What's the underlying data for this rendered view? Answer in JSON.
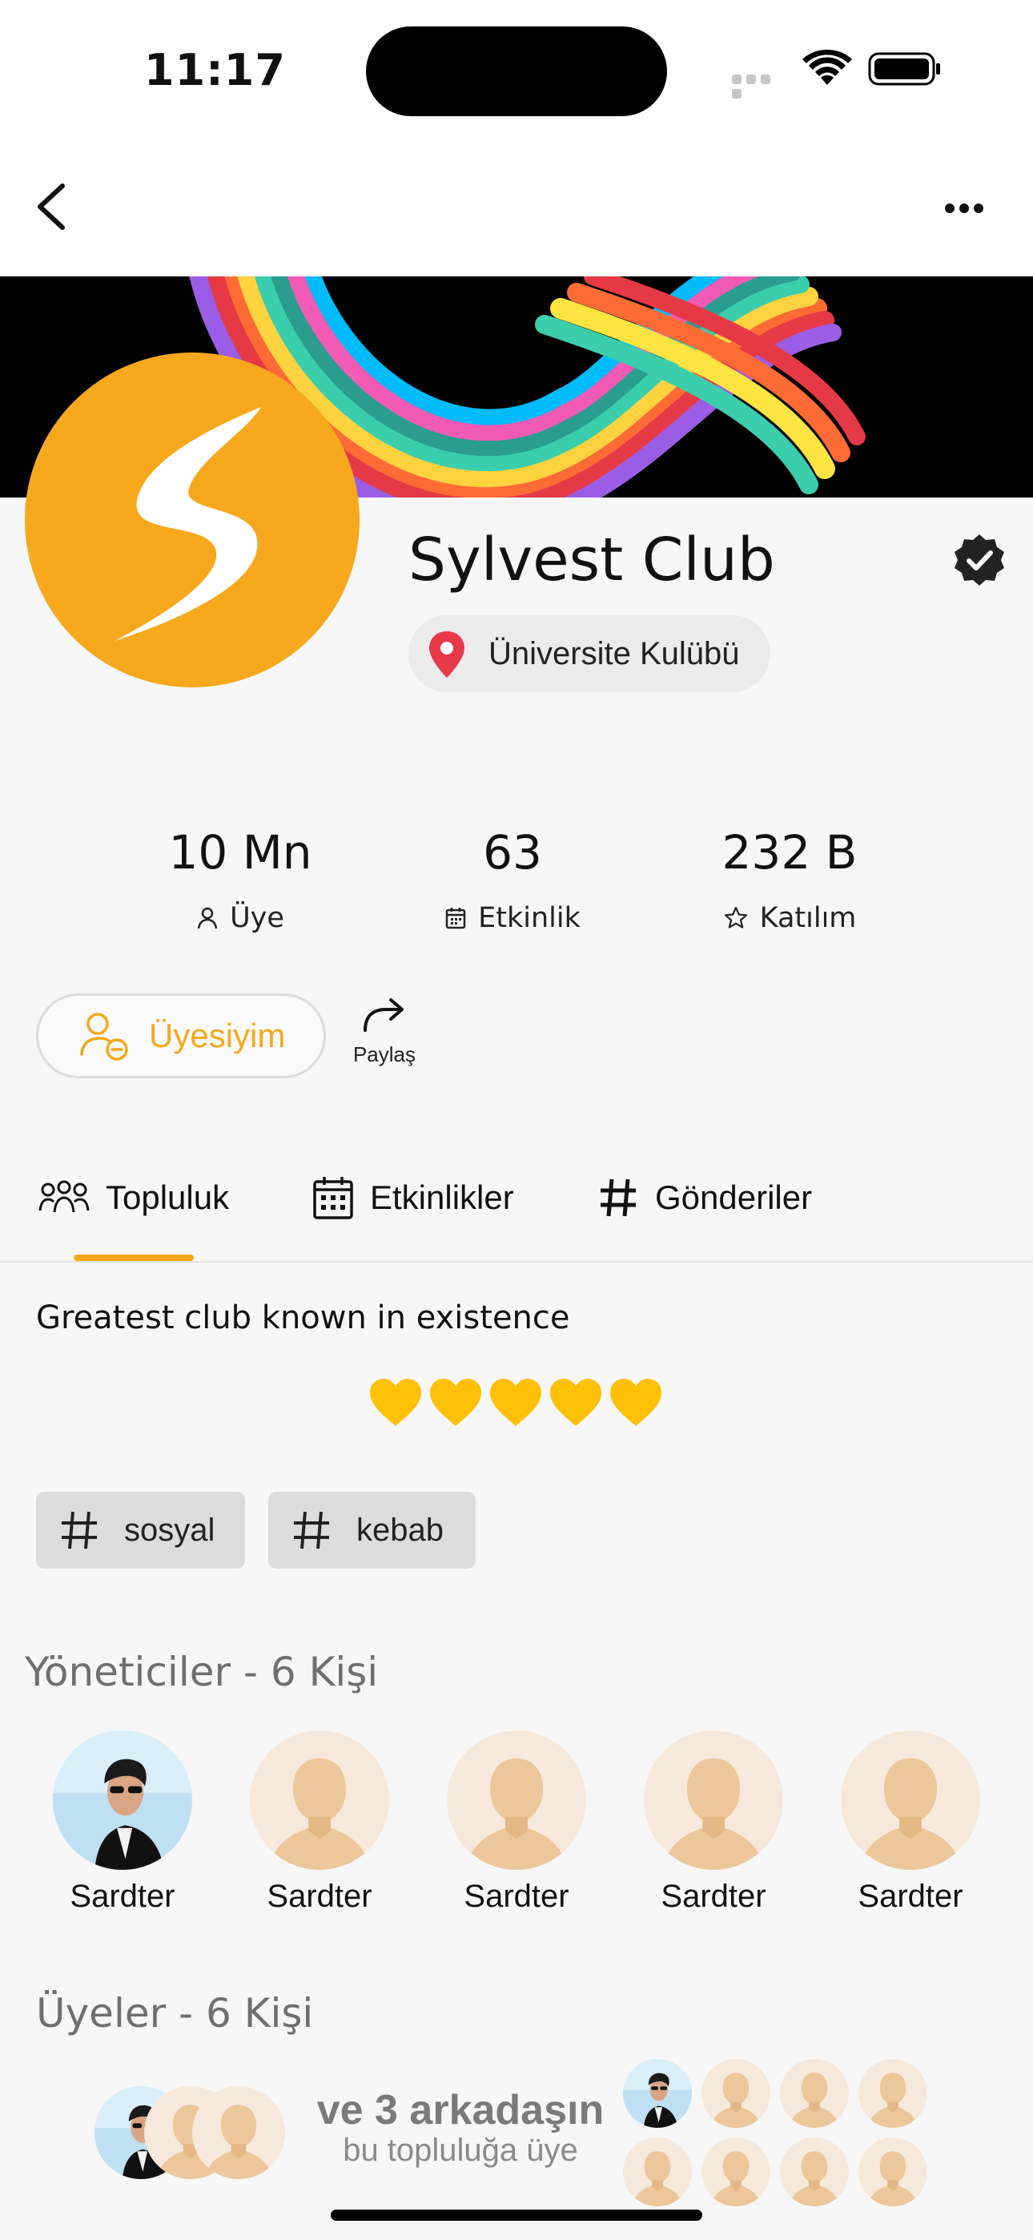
{
  "status_bar": {
    "time": "11:17"
  },
  "club": {
    "name": "Sylvest Club",
    "type": "Üniversite Kulübü",
    "verified": true,
    "accent_color": "#F6A81C"
  },
  "stats": [
    {
      "value": "10 Mn",
      "label": "Üye",
      "icon": "person-icon"
    },
    {
      "value": "63",
      "label": "Etkinlik",
      "icon": "calendar-icon"
    },
    {
      "value": "232 B",
      "label": "Katılım",
      "icon": "star-icon"
    }
  ],
  "actions": {
    "member_label": "Üyesiyim",
    "share_label": "Paylaş"
  },
  "tabs": [
    {
      "label": "Topluluk",
      "icon": "community-icon",
      "active": true
    },
    {
      "label": "Etkinlikler",
      "icon": "calendar-icon",
      "active": false
    },
    {
      "label": "Gönderiler",
      "icon": "hashtag-icon",
      "active": false
    }
  ],
  "about": {
    "description": "Greatest club known in existence",
    "hearts": 5,
    "tags": [
      "sosyal",
      "kebab"
    ]
  },
  "admins": {
    "heading": "Yöneticiler - 6 Kişi",
    "people": [
      {
        "name": "Sardter",
        "photo": true
      },
      {
        "name": "Sardter",
        "photo": false
      },
      {
        "name": "Sardter",
        "photo": false
      },
      {
        "name": "Sardter",
        "photo": false
      },
      {
        "name": "Sardter",
        "photo": false
      }
    ]
  },
  "members": {
    "heading": "Üyeler - 6 Kişi",
    "friends_count": "ve 3 arkadaşın",
    "friends_sub": "bu topluluğa üye"
  }
}
